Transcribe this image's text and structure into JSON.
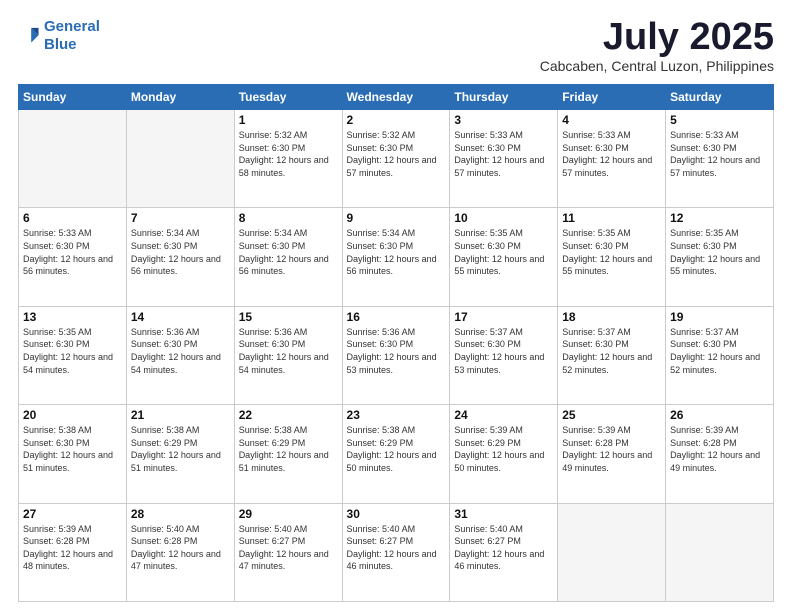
{
  "header": {
    "logo_line1": "General",
    "logo_line2": "Blue",
    "month": "July 2025",
    "location": "Cabcaben, Central Luzon, Philippines"
  },
  "weekdays": [
    "Sunday",
    "Monday",
    "Tuesday",
    "Wednesday",
    "Thursday",
    "Friday",
    "Saturday"
  ],
  "weeks": [
    [
      {
        "day": "",
        "info": ""
      },
      {
        "day": "",
        "info": ""
      },
      {
        "day": "1",
        "info": "Sunrise: 5:32 AM\nSunset: 6:30 PM\nDaylight: 12 hours and 58 minutes."
      },
      {
        "day": "2",
        "info": "Sunrise: 5:32 AM\nSunset: 6:30 PM\nDaylight: 12 hours and 57 minutes."
      },
      {
        "day": "3",
        "info": "Sunrise: 5:33 AM\nSunset: 6:30 PM\nDaylight: 12 hours and 57 minutes."
      },
      {
        "day": "4",
        "info": "Sunrise: 5:33 AM\nSunset: 6:30 PM\nDaylight: 12 hours and 57 minutes."
      },
      {
        "day": "5",
        "info": "Sunrise: 5:33 AM\nSunset: 6:30 PM\nDaylight: 12 hours and 57 minutes."
      }
    ],
    [
      {
        "day": "6",
        "info": "Sunrise: 5:33 AM\nSunset: 6:30 PM\nDaylight: 12 hours and 56 minutes."
      },
      {
        "day": "7",
        "info": "Sunrise: 5:34 AM\nSunset: 6:30 PM\nDaylight: 12 hours and 56 minutes."
      },
      {
        "day": "8",
        "info": "Sunrise: 5:34 AM\nSunset: 6:30 PM\nDaylight: 12 hours and 56 minutes."
      },
      {
        "day": "9",
        "info": "Sunrise: 5:34 AM\nSunset: 6:30 PM\nDaylight: 12 hours and 56 minutes."
      },
      {
        "day": "10",
        "info": "Sunrise: 5:35 AM\nSunset: 6:30 PM\nDaylight: 12 hours and 55 minutes."
      },
      {
        "day": "11",
        "info": "Sunrise: 5:35 AM\nSunset: 6:30 PM\nDaylight: 12 hours and 55 minutes."
      },
      {
        "day": "12",
        "info": "Sunrise: 5:35 AM\nSunset: 6:30 PM\nDaylight: 12 hours and 55 minutes."
      }
    ],
    [
      {
        "day": "13",
        "info": "Sunrise: 5:35 AM\nSunset: 6:30 PM\nDaylight: 12 hours and 54 minutes."
      },
      {
        "day": "14",
        "info": "Sunrise: 5:36 AM\nSunset: 6:30 PM\nDaylight: 12 hours and 54 minutes."
      },
      {
        "day": "15",
        "info": "Sunrise: 5:36 AM\nSunset: 6:30 PM\nDaylight: 12 hours and 54 minutes."
      },
      {
        "day": "16",
        "info": "Sunrise: 5:36 AM\nSunset: 6:30 PM\nDaylight: 12 hours and 53 minutes."
      },
      {
        "day": "17",
        "info": "Sunrise: 5:37 AM\nSunset: 6:30 PM\nDaylight: 12 hours and 53 minutes."
      },
      {
        "day": "18",
        "info": "Sunrise: 5:37 AM\nSunset: 6:30 PM\nDaylight: 12 hours and 52 minutes."
      },
      {
        "day": "19",
        "info": "Sunrise: 5:37 AM\nSunset: 6:30 PM\nDaylight: 12 hours and 52 minutes."
      }
    ],
    [
      {
        "day": "20",
        "info": "Sunrise: 5:38 AM\nSunset: 6:30 PM\nDaylight: 12 hours and 51 minutes."
      },
      {
        "day": "21",
        "info": "Sunrise: 5:38 AM\nSunset: 6:29 PM\nDaylight: 12 hours and 51 minutes."
      },
      {
        "day": "22",
        "info": "Sunrise: 5:38 AM\nSunset: 6:29 PM\nDaylight: 12 hours and 51 minutes."
      },
      {
        "day": "23",
        "info": "Sunrise: 5:38 AM\nSunset: 6:29 PM\nDaylight: 12 hours and 50 minutes."
      },
      {
        "day": "24",
        "info": "Sunrise: 5:39 AM\nSunset: 6:29 PM\nDaylight: 12 hours and 50 minutes."
      },
      {
        "day": "25",
        "info": "Sunrise: 5:39 AM\nSunset: 6:28 PM\nDaylight: 12 hours and 49 minutes."
      },
      {
        "day": "26",
        "info": "Sunrise: 5:39 AM\nSunset: 6:28 PM\nDaylight: 12 hours and 49 minutes."
      }
    ],
    [
      {
        "day": "27",
        "info": "Sunrise: 5:39 AM\nSunset: 6:28 PM\nDaylight: 12 hours and 48 minutes."
      },
      {
        "day": "28",
        "info": "Sunrise: 5:40 AM\nSunset: 6:28 PM\nDaylight: 12 hours and 47 minutes."
      },
      {
        "day": "29",
        "info": "Sunrise: 5:40 AM\nSunset: 6:27 PM\nDaylight: 12 hours and 47 minutes."
      },
      {
        "day": "30",
        "info": "Sunrise: 5:40 AM\nSunset: 6:27 PM\nDaylight: 12 hours and 46 minutes."
      },
      {
        "day": "31",
        "info": "Sunrise: 5:40 AM\nSunset: 6:27 PM\nDaylight: 12 hours and 46 minutes."
      },
      {
        "day": "",
        "info": ""
      },
      {
        "day": "",
        "info": ""
      }
    ]
  ]
}
